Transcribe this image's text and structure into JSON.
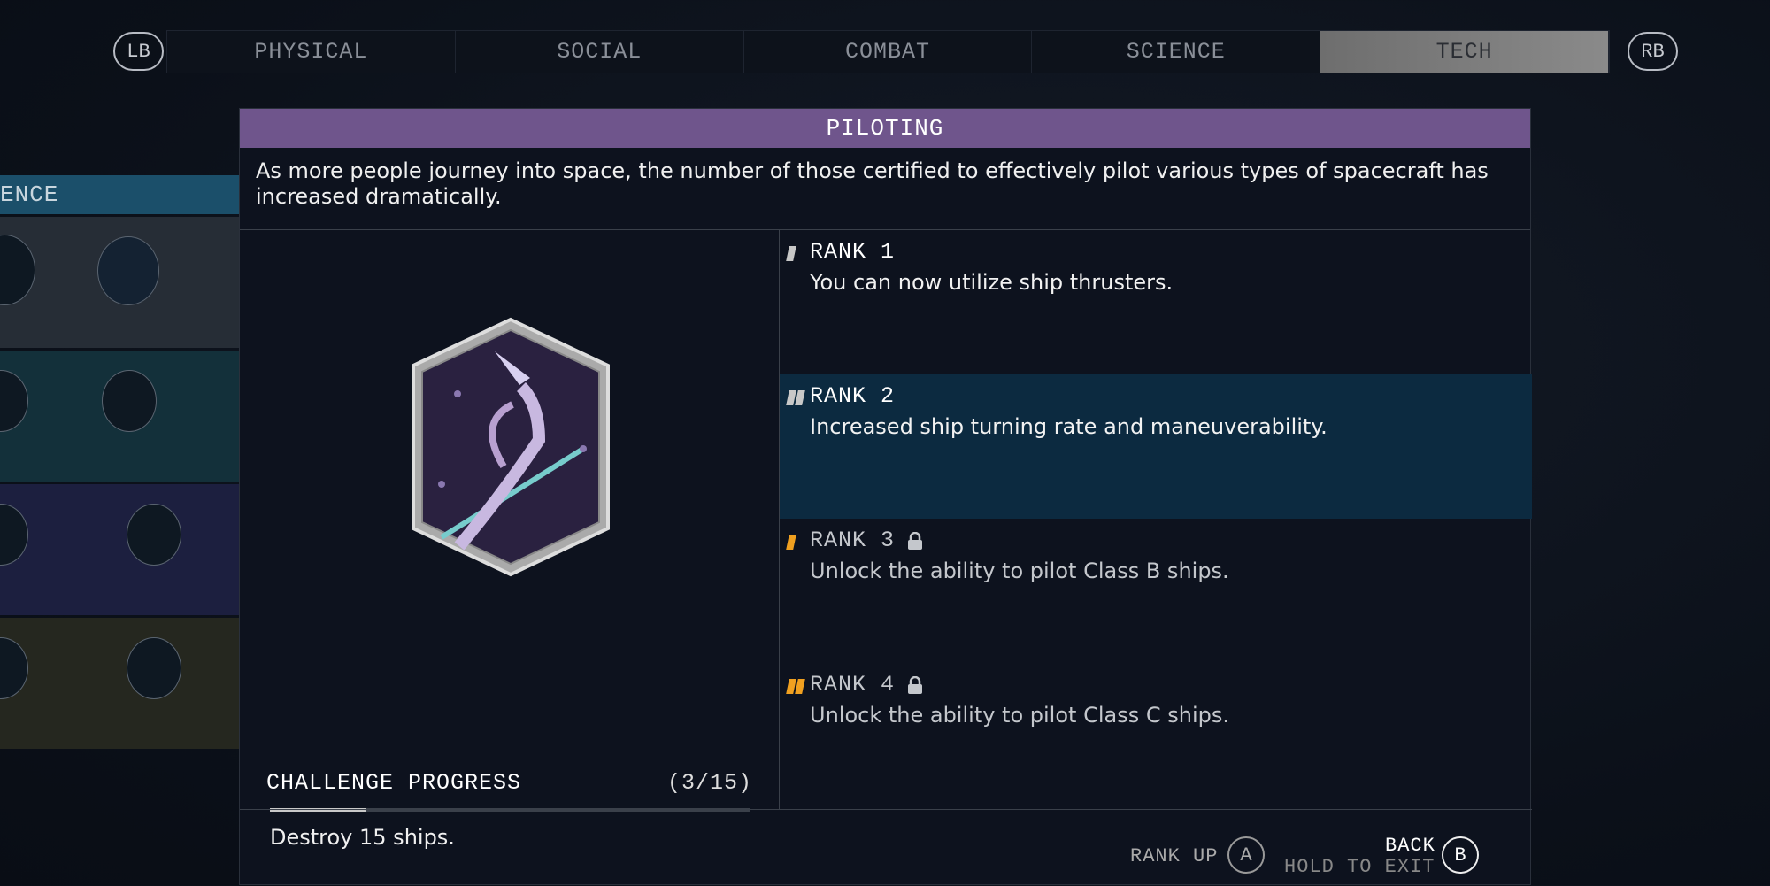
{
  "tabs": {
    "left_button": "LB",
    "right_button": "RB",
    "items": [
      {
        "label": "PHYSICAL"
      },
      {
        "label": "SOCIAL"
      },
      {
        "label": "COMBAT"
      },
      {
        "label": "SCIENCE"
      },
      {
        "label": "TECH",
        "active": true
      }
    ]
  },
  "left_panel": {
    "header": "ENCE",
    "row_colors": [
      "#262d36",
      "#13303a",
      "#1c1f3f",
      "#25271f"
    ]
  },
  "skill": {
    "title": "PILOTING",
    "description": "As more people journey into space, the number of those certified to effectively pilot various types of spacecraft has increased dramatically.",
    "badge_icon": "piloting-patch-icon",
    "challenge": {
      "label": "CHALLENGE PROGRESS",
      "count": "(3/15)",
      "current": 3,
      "total": 15,
      "text": "Destroy 15 ships."
    },
    "ranks": [
      {
        "title": "RANK 1",
        "desc": "You can now utilize ship thrusters.",
        "locked": false,
        "selected": false
      },
      {
        "title": "RANK 2",
        "desc": "Increased ship turning rate and maneuverability.",
        "locked": false,
        "selected": true
      },
      {
        "title": "RANK 3",
        "desc": "Unlock the ability to pilot Class B ships.",
        "locked": true,
        "selected": false
      },
      {
        "title": "RANK 4",
        "desc": "Unlock the ability to pilot Class C ships.",
        "locked": true,
        "selected": false
      }
    ]
  },
  "footer": {
    "rank_up": "RANK UP",
    "rank_up_button": "A",
    "hold_to_exit": "HOLD TO EXIT",
    "back": "BACK",
    "back_button": "B"
  },
  "colors": {
    "header": "#6f558c",
    "selected": "#0c2a40",
    "locked_mark": "#f0a020",
    "unlocked_mark": "#c8c8c8"
  }
}
